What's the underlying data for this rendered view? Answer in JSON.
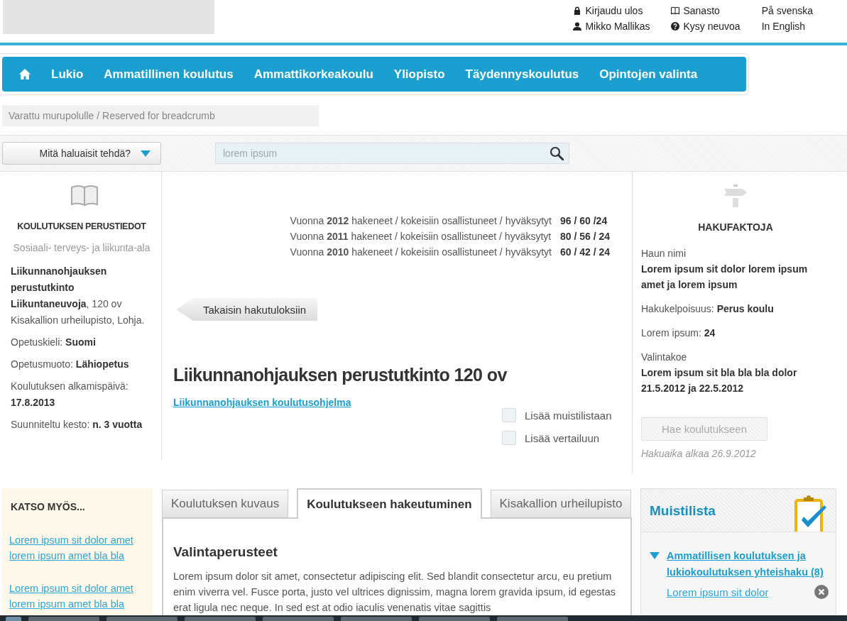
{
  "header": {
    "account_links": [
      {
        "kind": "lock",
        "text": "Kirjaudu ulos"
      },
      {
        "kind": "user",
        "text": "Mikko Mallikas"
      }
    ],
    "help_links": [
      {
        "kind": "book",
        "text": "Sanasto"
      },
      {
        "kind": "question",
        "text": "Kysy neuvoa"
      }
    ],
    "languages": [
      "På svenska",
      "In English"
    ]
  },
  "nav": {
    "items": [
      "Lukio",
      "Ammatillinen koulutus",
      "Ammattikorkeakoulu",
      "Yliopisto",
      "Täydennyskoulutus",
      "Opintojen valinta"
    ]
  },
  "breadcrumb": "Varattu murupolulle / Reserved for breadcrumb",
  "toolbar": {
    "dropdown": "Mitä haluaisit tehdä?",
    "search": {
      "placeholder": "lorem ipsum"
    }
  },
  "basics": {
    "heading": "KOULUTUKSEN PERUSTIEDOT",
    "field": "Sosiaali- terveys- ja liikunta-ala",
    "description": "**Liikunnanohjauksen perustutkinto Liikuntaneuvoja**, 120 ov Kisakallion urheilupisto, Lohja.",
    "facts": [
      "Opetuskieli: **Suomi**",
      "Opetusmuoto: **Lähiopetus**",
      "Koulutuksen alkamispäivä: **17.8.2013**",
      "Suunniteltu kesto: **n. 3 vuotta**"
    ]
  },
  "stats": [
    {
      "text": "Vuonna **2012** hakeneet / kokeisiin osallistuneet / hyväksytyt",
      "value": "96 / 60 /24"
    },
    {
      "text": "Vuonna **2011** hakeneet / kokeisiin osallistuneet / hyväksytyt",
      "value": "80 / 56 / 24"
    },
    {
      "text": "Vuonna **2010** hakeneet / kokeisiin osallistuneet / hyväksytyt",
      "value": "60 / 42 / 24"
    }
  ],
  "back_button": "Takaisin hakutuloksiin",
  "title": "Liikunnanohjauksen perustutkinto 120 ov",
  "program_link": "Liikunnanohjauksen koulutusohjelma",
  "options": [
    {
      "label": "Lisää muistilistaan",
      "checked": false
    },
    {
      "label": "Lisää vertailuun",
      "checked": false
    }
  ],
  "search_facts": {
    "heading": "HAKUFAKTOJA",
    "facts": [
      {
        "kind": "stacked",
        "label": "Haun nimi",
        "value": "Lorem ipsum sit dolor lorem ipsum amet ja lorem ipsum"
      },
      {
        "kind": "inline",
        "label": "Hakukelpoisuus:",
        "value": "Perus koulu"
      },
      {
        "kind": "inline",
        "label": "Lorem ipsum:",
        "value": "24"
      },
      {
        "kind": "stacked",
        "label": "Valintakoe",
        "value": "Lorem ipsum sit bla bla bla dolor 21.5.2012 ja 22.5.2012"
      }
    ],
    "apply_button": {
      "label": "Hae koulutukseen",
      "disabled": true
    },
    "note": "Hakuaika alkaa 26.9.2012"
  },
  "see_also": {
    "heading": "KATSO MYÖS...",
    "links": [
      "Lorem ipsum sit dolor amet lorem ipsum amet bla bla",
      "Lorem ipsum sit dolor amet lorem ipsum amet bla bla"
    ]
  },
  "tabs": [
    {
      "label": "Koulutuksen kuvaus",
      "selected": false
    },
    {
      "label": "Koulutukseen hakeutuminen",
      "selected": true
    },
    {
      "label": "Kisakallion urheilupisto",
      "selected": false
    }
  ],
  "tab_content": {
    "heading": "Valintaperusteet",
    "text": "Lorem ipsum dolor sit amet, consectetur adipiscing elit. Sed blandit consectetur arcu, eu pretium enim viverra vel. Fusce porta, justo vel ultrices dignissim, magna lorem gravida ipsum, id egestas erat ligula nec neque. In sed est at odio iaculis venenatis vitae sagittis"
  },
  "memo": {
    "title": "Muistilista",
    "groups": [
      {
        "label": "Ammatillisen koulutuksen ja lukiokoulutuksen yhteishaku (8)",
        "expanded": true,
        "items": [
          "Lorem ipsum sit dolor"
        ]
      }
    ]
  }
}
